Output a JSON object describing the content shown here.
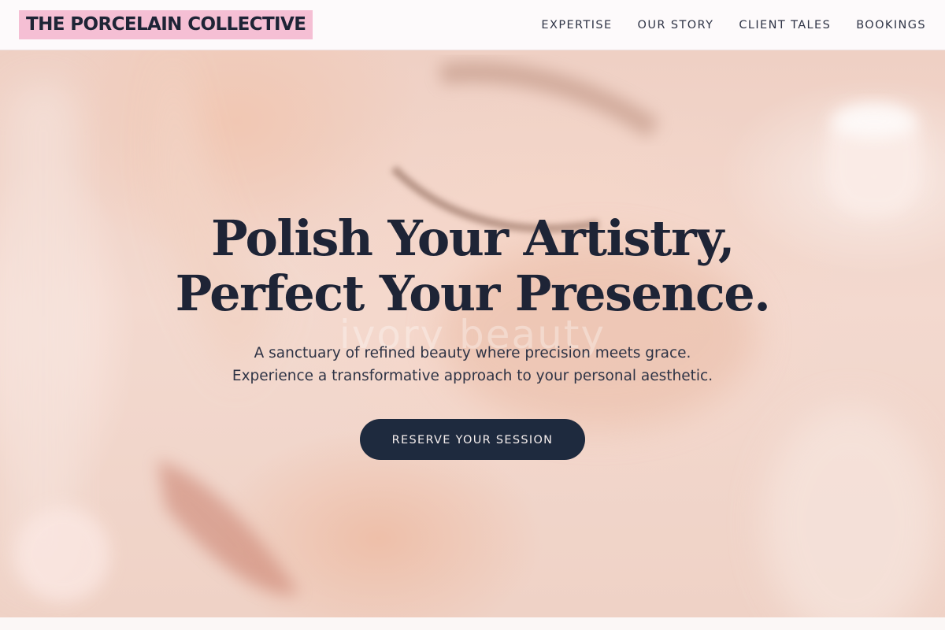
{
  "header": {
    "logo_text": "THE PORCELAIN COLLECTIVE",
    "nav": [
      {
        "label": "EXPERTISE"
      },
      {
        "label": "OUR STORY"
      },
      {
        "label": "CLIENT TALES"
      },
      {
        "label": "BOOKINGS"
      }
    ]
  },
  "hero": {
    "headline_line1": "Polish Your Artistry,",
    "headline_line2": "Perfect Your Presence.",
    "watermark": "ivory beauty",
    "sub_line1": "A sanctuary of refined beauty where precision meets grace.",
    "sub_line2": "Experience a transformative approach to your personal aesthetic.",
    "cta_label": "RESERVE YOUR SESSION",
    "background_image": "blurred close-up of a face with closed eyes and a hand"
  },
  "colors": {
    "logo_bg": "#f5bfd4",
    "navy": "#1e2436",
    "button_bg": "#1e2a3e",
    "hero_tint": "#f3d9cf"
  }
}
